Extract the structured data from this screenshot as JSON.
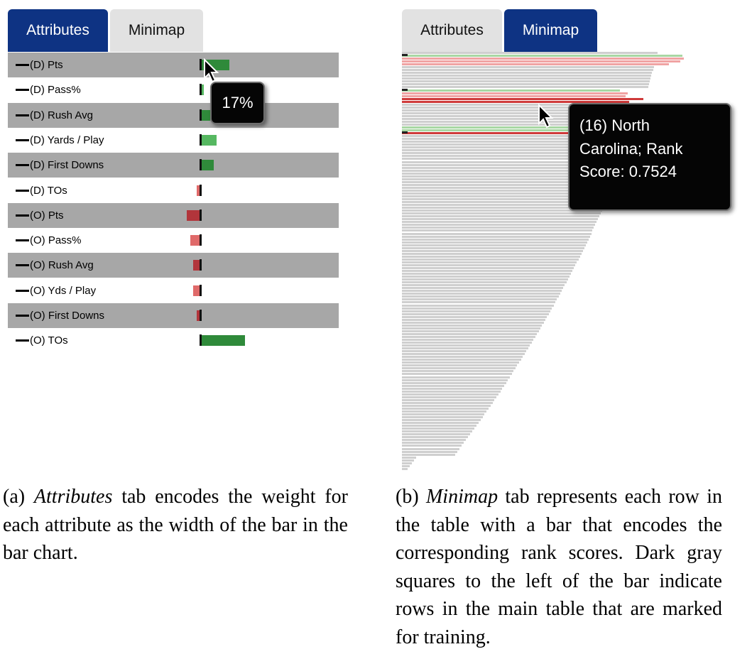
{
  "left_panel": {
    "tabs": [
      {
        "label": "Attributes",
        "active": true
      },
      {
        "label": "Minimap",
        "active": false
      }
    ],
    "rows": [
      {
        "label": "(D) Pts",
        "weight_pct": 9,
        "direction": "positive",
        "color": "#2f8a3a"
      },
      {
        "label": "(D) Pass%",
        "weight_pct": 1,
        "direction": "positive",
        "color": "#56b861"
      },
      {
        "label": "(D) Rush Avg",
        "weight_pct": 3,
        "direction": "positive",
        "color": "#2f8a3a"
      },
      {
        "label": "(D) Yards / Play",
        "weight_pct": 5,
        "direction": "positive",
        "color": "#56b861"
      },
      {
        "label": "(D) First Downs",
        "weight_pct": 4,
        "direction": "positive",
        "color": "#2f8a3a"
      },
      {
        "label": "(D) TOs",
        "weight_pct": 1,
        "direction": "negative",
        "color": "#e06a6a"
      },
      {
        "label": "(O) Pts",
        "weight_pct": 4,
        "direction": "negative",
        "color": "#b2353b"
      },
      {
        "label": "(O) Pass%",
        "weight_pct": 3,
        "direction": "negative",
        "color": "#e06a6a"
      },
      {
        "label": "(O) Rush Avg",
        "weight_pct": 2,
        "direction": "negative",
        "color": "#b2353b"
      },
      {
        "label": "(O) Yds / Play",
        "weight_pct": 2,
        "direction": "negative",
        "color": "#e06a6a"
      },
      {
        "label": "(O) First Downs",
        "weight_pct": 1,
        "direction": "negative",
        "color": "#b2353b"
      },
      {
        "label": "(O) TOs",
        "weight_pct": 14,
        "direction": "positive",
        "color": "#2f8a3a"
      }
    ],
    "tooltip": "17%"
  },
  "right_panel": {
    "tabs": [
      {
        "label": "Attributes",
        "active": false
      },
      {
        "label": "Minimap",
        "active": true
      }
    ],
    "tooltip_lines": [
      "(16) North",
      "Carolina; Rank",
      "Score: 0.7524"
    ]
  },
  "colors": {
    "tab_active": "#0e3383",
    "tab_inactive": "#e2e2e2",
    "row_shaded": "#a7a7a7",
    "bar_gray": "#cfcfcf",
    "bar_green": "#a8d7a3",
    "bar_red_light": "#f0a3a3",
    "bar_red_dark": "#cf3a3a"
  },
  "captions": {
    "a": {
      "prefix": "(a) ",
      "emph": "Attributes",
      "text": " tab encodes the weight for each attribute as the width of the bar in the bar chart."
    },
    "b": {
      "prefix": "(b) ",
      "emph": "Minimap",
      "text": " tab represents each row in the table with a bar that encodes the corresponding rank scores. Dark gray squares to the left of the bar indicate rows in the main table that are marked for training."
    }
  }
}
